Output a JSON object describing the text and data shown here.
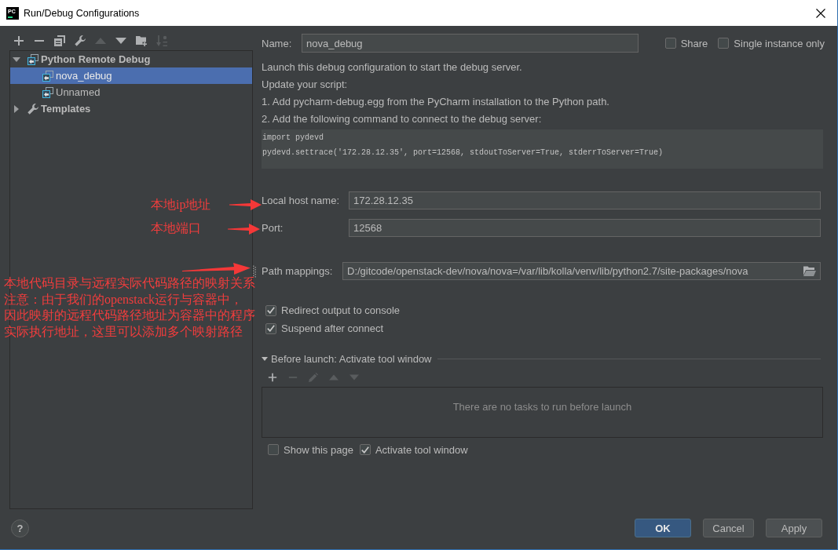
{
  "window": {
    "logo_text": "PC",
    "title": "Run/Debug Configurations"
  },
  "sidebar": {
    "toolbar": [
      {
        "kind": "plus",
        "disabled": false
      },
      {
        "kind": "minus",
        "disabled": false
      },
      {
        "kind": "copy",
        "disabled": false
      },
      {
        "kind": "wrench",
        "disabled": false
      },
      {
        "kind": "up",
        "disabled": true
      },
      {
        "kind": "down",
        "disabled": false
      },
      {
        "kind": "folder",
        "disabled": false
      },
      {
        "kind": "sort",
        "disabled": true
      }
    ],
    "tree": [
      {
        "kind": "group",
        "label": "Python Remote Debug",
        "expanded": true,
        "selected": false,
        "children": [
          {
            "kind": "config",
            "label": "nova_debug",
            "selected": true
          },
          {
            "kind": "config",
            "label": "Unnamed",
            "selected": false
          }
        ]
      },
      {
        "kind": "templates",
        "label": "Templates",
        "expanded": false,
        "selected": false
      }
    ]
  },
  "form": {
    "name": {
      "label": "Name:",
      "value": "nova_debug"
    },
    "options": [
      {
        "label": "Share",
        "checked": false
      },
      {
        "label": "Single instance only",
        "checked": false
      }
    ],
    "description": [
      "Launch this debug configuration to start the debug server.",
      "Update your script:",
      "1. Add pycharm-debug.egg from the PyCharm installation to the Python path.",
      "2. Add the following command to connect to the debug server:"
    ],
    "code": [
      "import pydevd",
      "pydevd.settrace('172.28.12.35', port=12568, stdoutToServer=True, stderrToServer=True)"
    ],
    "fields": [
      {
        "kind": "text",
        "label": "Local host name:",
        "value": "172.28.12.35"
      },
      {
        "kind": "text",
        "label": "Port:",
        "value": "12568"
      },
      {
        "kind": "path",
        "label": "Path mappings:",
        "value": "D:/gitcode/openstack-dev/nova/nova=/var/lib/kolla/venv/lib/python2.7/site-packages/nova"
      }
    ],
    "checkboxes": [
      {
        "label": "Redirect output to console",
        "checked": true
      },
      {
        "label": "Suspend after connect",
        "checked": true
      }
    ],
    "before_launch": {
      "title": "Before launch: Activate tool window",
      "expanded": true,
      "toolbar": [
        {
          "kind": "plus",
          "disabled": false
        },
        {
          "kind": "minus",
          "disabled": true
        },
        {
          "kind": "pencil",
          "disabled": true
        },
        {
          "kind": "up",
          "disabled": true
        },
        {
          "kind": "down",
          "disabled": true
        }
      ],
      "empty_text": "There are no tasks to run before launch",
      "options": [
        {
          "label": "Show this page",
          "checked": false
        },
        {
          "label": "Activate tool window",
          "checked": true
        }
      ]
    }
  },
  "annotations": [
    {
      "kind": "label",
      "lines": [
        "本地ip地址"
      ]
    },
    {
      "kind": "label",
      "lines": [
        "本地端口"
      ]
    },
    {
      "kind": "note",
      "lines": [
        "本地代码目录与远程实际代码路径的映射关系",
        "注意：由于我们的openstack运行与容器中，",
        "因此映射的远程代码路径地址为容器中的程序",
        "实际执行地址，这里可以添加多个映射路径"
      ]
    }
  ],
  "footer": {
    "help": "?",
    "buttons": [
      {
        "kind": "ok",
        "label": "OK"
      },
      {
        "kind": "cancel",
        "label": "Cancel"
      },
      {
        "kind": "apply",
        "label": "Apply"
      }
    ]
  }
}
